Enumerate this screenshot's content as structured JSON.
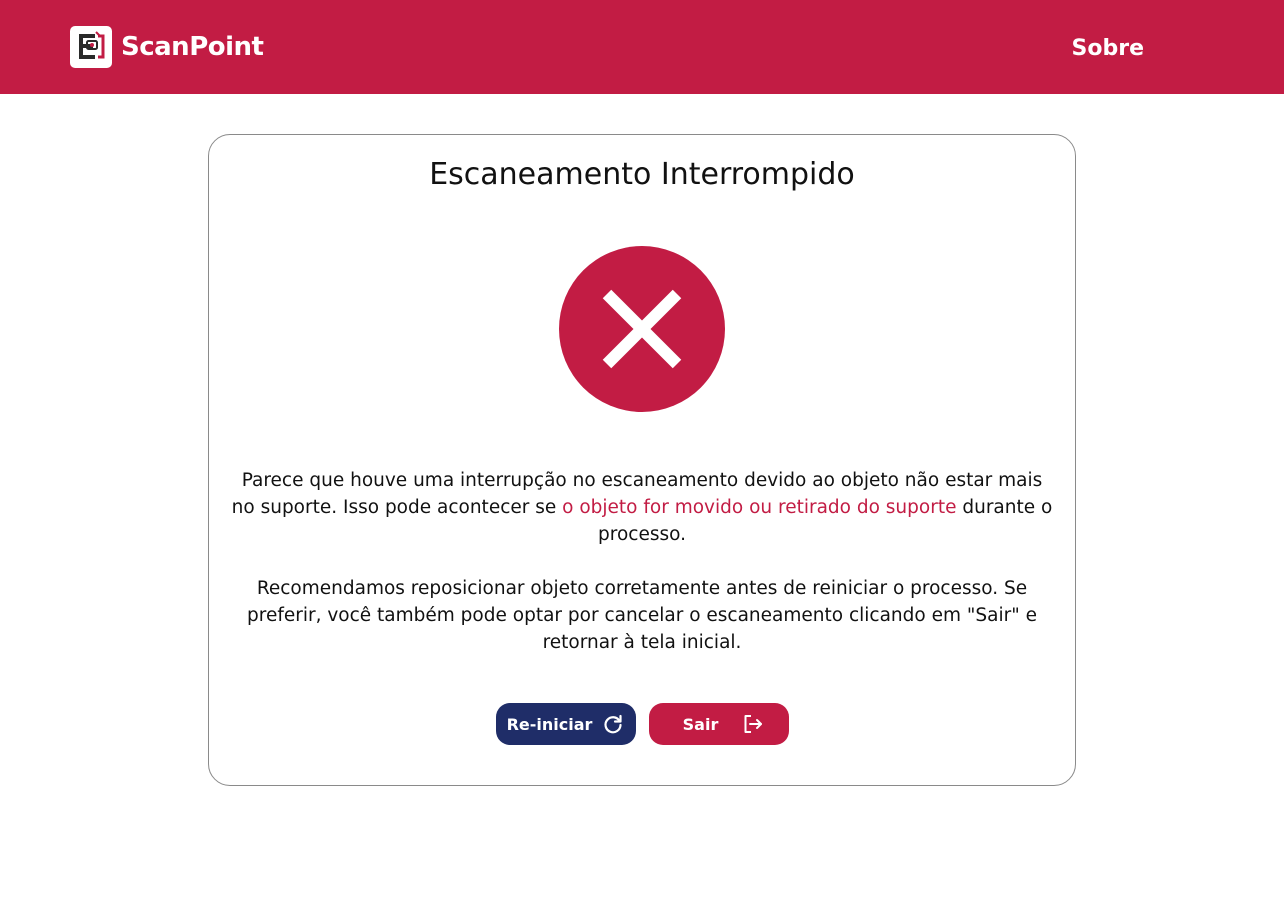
{
  "header": {
    "brand": "ScanPoint",
    "nav_about": "Sobre"
  },
  "card": {
    "title": "Escaneamento Interrompido",
    "status_icon": "error-x-icon",
    "message1_before": "Parece que houve uma interrupção no escaneamento devido ao objeto não estar mais no suporte. Isso pode acontecer se ",
    "message1_highlight": "o objeto for movido ou retirado do suporte",
    "message1_after": " durante o processo.",
    "message2": "Recomendamos reposicionar objeto corretamente antes de reiniciar o processo. Se preferir, você também pode optar por cancelar o escaneamento clicando em \"Sair\" e retornar à tela inicial."
  },
  "actions": {
    "restart_label": "Re-iniciar",
    "restart_icon": "refresh-icon",
    "exit_label": "Sair",
    "exit_icon": "logout-icon"
  },
  "colors": {
    "brand": "#c21c44",
    "primary_button": "#1f2d68",
    "text": "#111111"
  }
}
